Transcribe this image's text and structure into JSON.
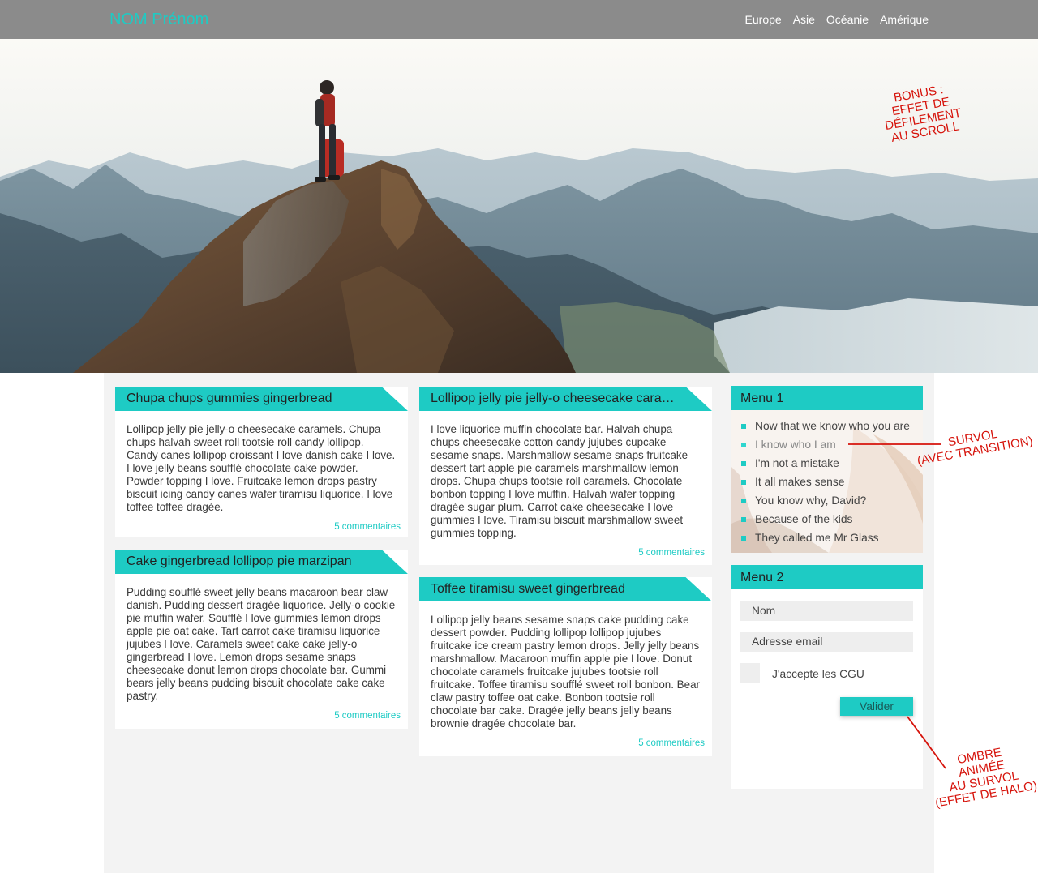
{
  "header": {
    "brand": "NOM Prénom",
    "nav": [
      "Europe",
      "Asie",
      "Océanie",
      "Amérique"
    ]
  },
  "articles": [
    {
      "title": "Chupa chups gummies gingerbread",
      "body": "Lollipop jelly pie jelly-o cheesecake caramels. Chupa chups halvah sweet roll tootsie roll candy lollipop. Candy canes lollipop croissant I love danish cake I love. I love jelly beans soufflé chocolate cake powder. Powder topping I love. Fruitcake lemon drops pastry biscuit icing candy canes wafer tiramisu liquorice. I love toffee toffee dragée.",
      "comments": "5 commentaires"
    },
    {
      "title": "Cake gingerbread lollipop pie marzipan",
      "body": "Pudding soufflé sweet jelly beans macaroon bear claw danish. Pudding dessert dragée liquorice. Jelly-o cookie pie muffin wafer. Soufflé I love gummies lemon drops apple pie oat cake. Tart carrot cake tiramisu liquorice jujubes I love. Caramels sweet cake cake jelly-o gingerbread I love. Lemon drops sesame snaps cheesecake donut lemon drops chocolate bar. Gummi bears jelly beans pudding biscuit chocolate cake cake pastry.",
      "comments": "5 commentaires"
    },
    {
      "title": "Lollipop jelly pie jelly-o cheesecake caramels",
      "body": "I love liquorice muffin chocolate bar. Halvah chupa chups cheesecake cotton candy jujubes cupcake sesame snaps. Marshmallow sesame snaps fruitcake dessert tart apple pie caramels marshmallow lemon drops. Chupa chups tootsie roll caramels. Chocolate bonbon topping I love muffin. Halvah wafer topping dragée sugar plum. Carrot cake cheesecake I love gummies I love. Tiramisu biscuit marshmallow sweet gummies topping.",
      "comments": "5 commentaires"
    },
    {
      "title": "Toffee tiramisu sweet gingerbread",
      "body": "Lollipop jelly beans sesame snaps cake pudding cake dessert powder. Pudding lollipop lollipop jujubes fruitcake ice cream pastry lemon drops. Jelly jelly beans marshmallow. Macaroon muffin apple pie I love. Donut chocolate caramels fruitcake jujubes tootsie roll fruitcake. Toffee tiramisu soufflé sweet roll bonbon. Bear claw pastry toffee oat cake. Bonbon tootsie roll chocolate bar cake. Dragée jelly beans jelly beans brownie dragée chocolate bar.",
      "comments": "5 commentaires"
    }
  ],
  "menu1": {
    "title": "Menu 1",
    "items": [
      "Now that we know who you are",
      "I know who I am",
      "I'm not a mistake",
      "It all makes sense",
      "You know why, David?",
      "Because of the kids",
      "They called me Mr Glass"
    ]
  },
  "menu2": {
    "title": "Menu 2",
    "name_placeholder": "Nom",
    "email_placeholder": "Adresse email",
    "checkbox_label": "J'accepte les CGU",
    "submit_label": "Valider"
  },
  "annotations": {
    "bonus": [
      "BONUS :",
      "EFFET DE",
      "DÉFILEMENT",
      "AU SCROLL"
    ],
    "survol": [
      "SURVOL",
      "(AVEC TRANSITION)"
    ],
    "ombre": [
      "OMBRE",
      "ANIMÉE",
      "AU SURVOL",
      "(EFFET DE HALO)"
    ]
  },
  "colors": {
    "accent": "#1ecbc4",
    "header_bg": "#8b8b8b",
    "content_bg": "#f3f3f3",
    "annotation": "#d6130b"
  }
}
